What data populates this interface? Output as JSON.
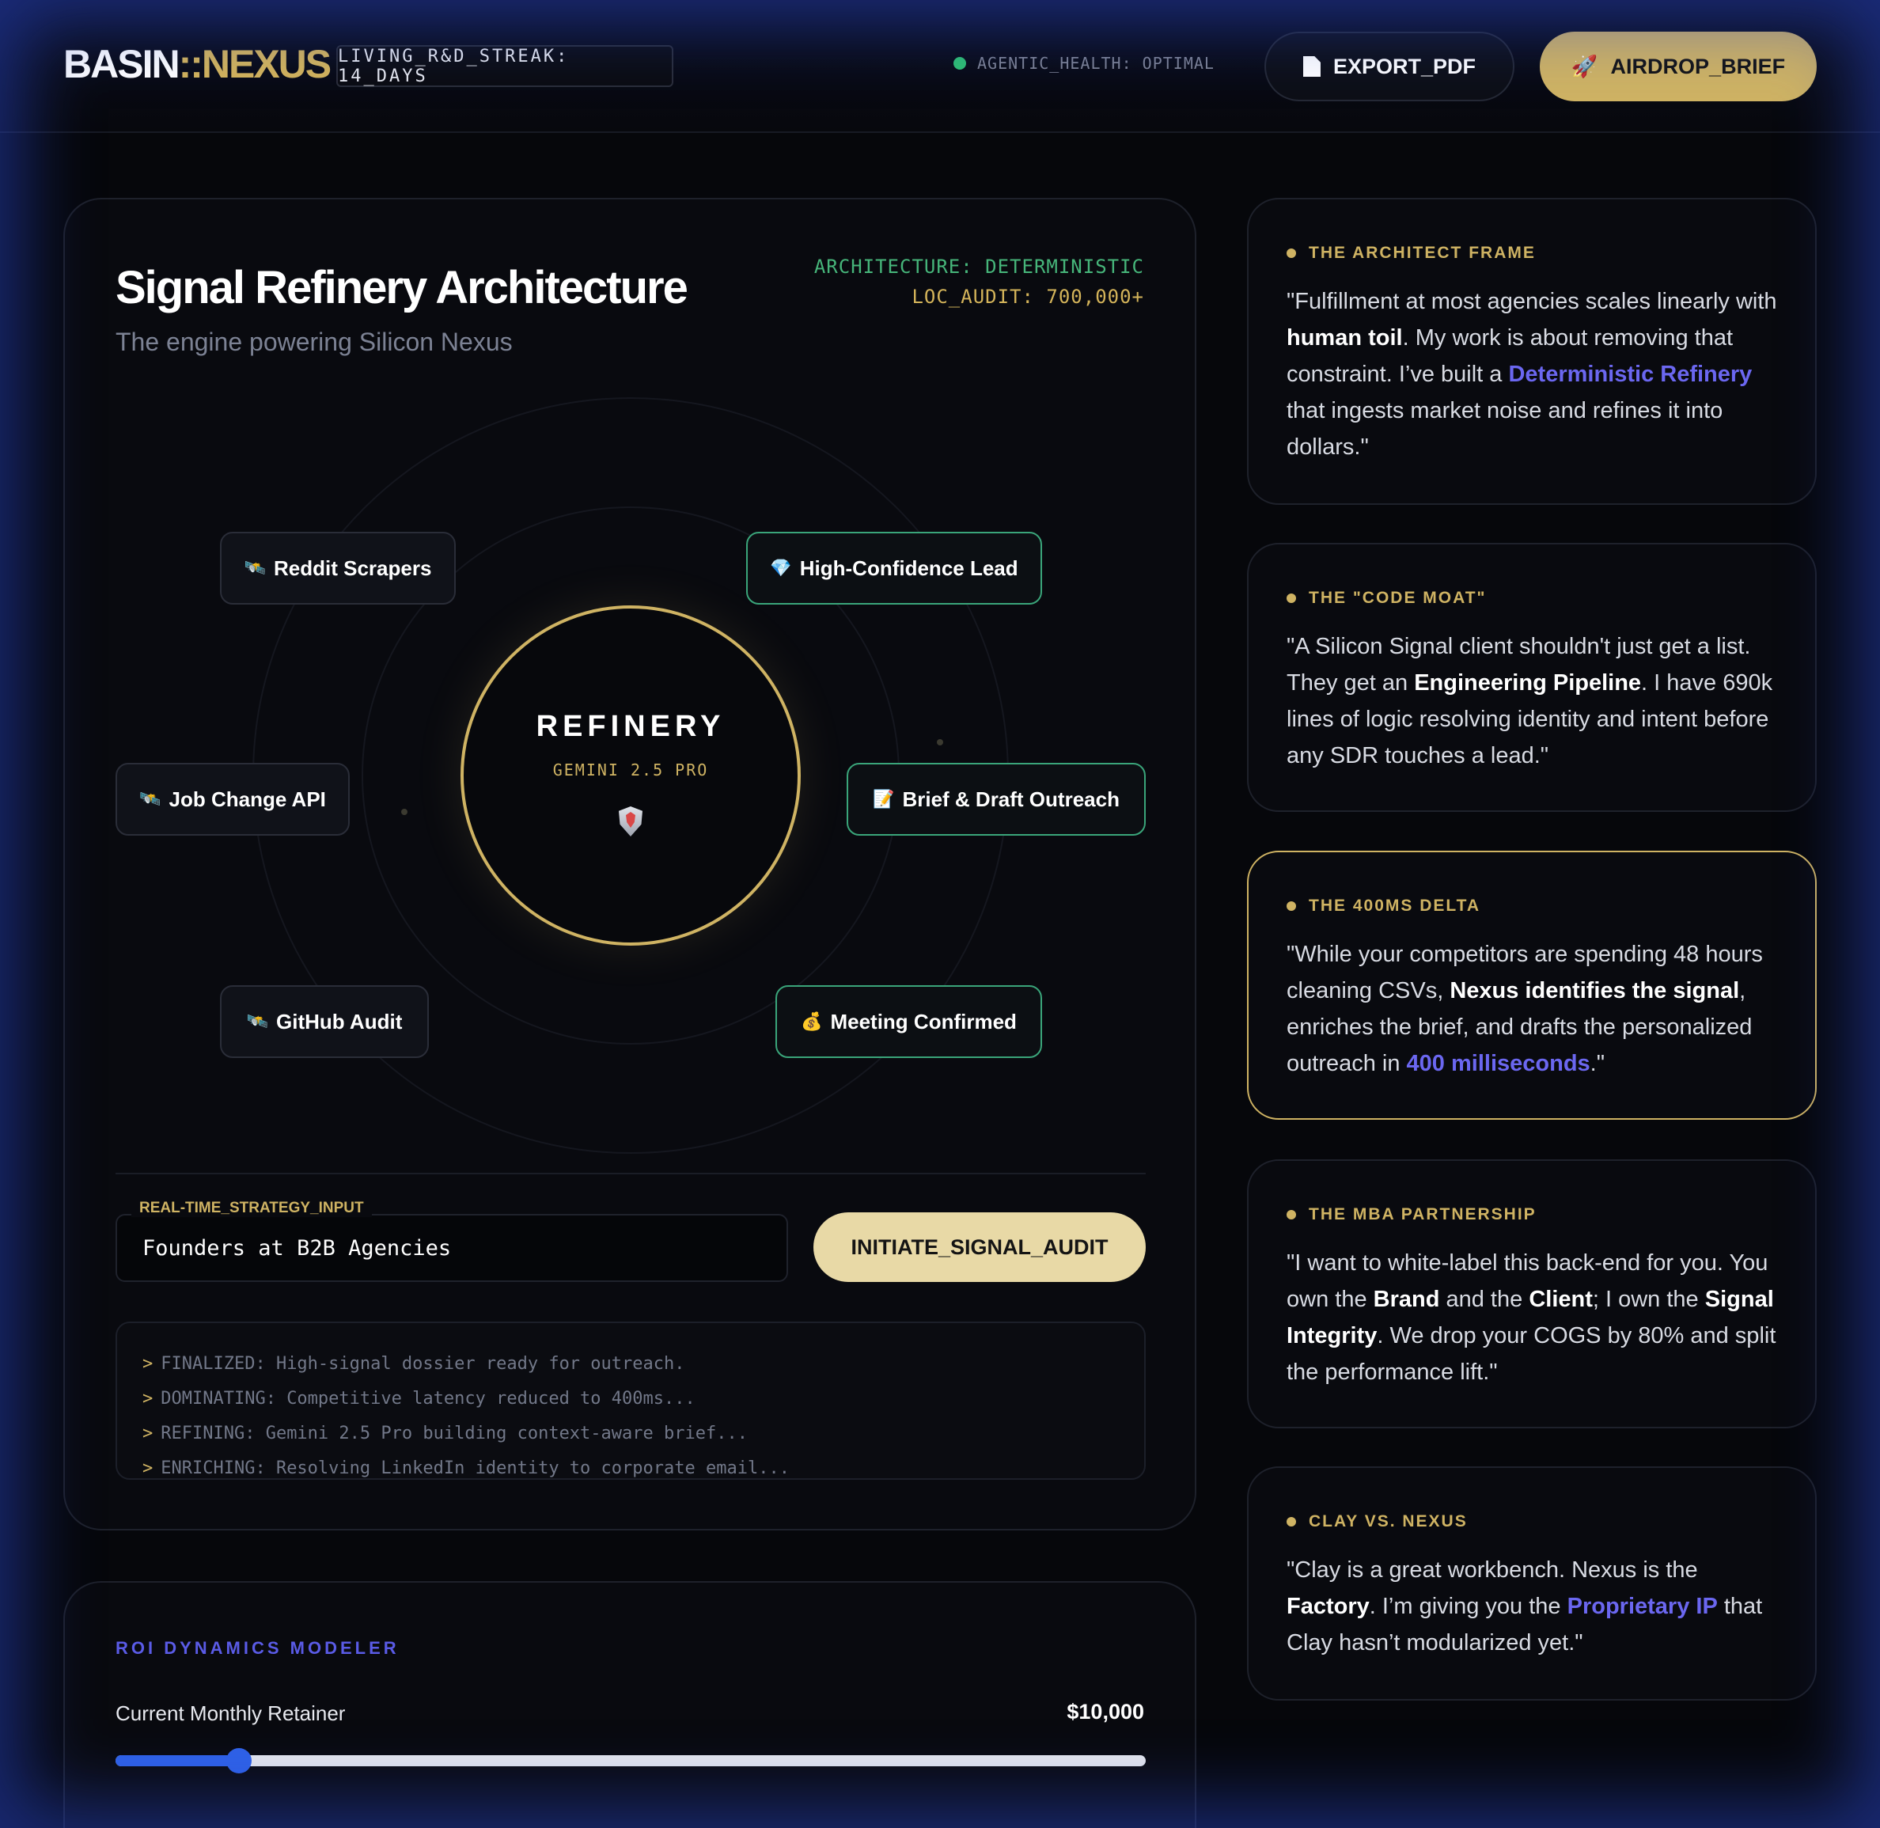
{
  "header": {
    "logo_part1": "BASIN",
    "logo_part2": "::NEXUS",
    "streak": "LIVING_R&D_STREAK: 14_DAYS",
    "health": "AGENTIC_HEALTH: OPTIMAL",
    "export_label": "EXPORT_PDF",
    "airdrop_label": "AIRDROP_BRIEF",
    "airdrop_emoji": "🚀"
  },
  "main": {
    "title": "Signal Refinery Architecture",
    "subtitle": "The engine powering Silicon Nexus",
    "arch_line1": "ARCHITECTURE: DETERMINISTIC",
    "arch_line2": "LOC_AUDIT: 700,000+",
    "core_title": "REFINERY",
    "core_sub": "GEMINI 2.5 PRO",
    "nodes": [
      {
        "emoji": "🛰️",
        "label": "Reddit Scrapers"
      },
      {
        "emoji": "🛰️",
        "label": "Job Change API"
      },
      {
        "emoji": "🛰️",
        "label": "GitHub Audit"
      },
      {
        "emoji": "💎",
        "label": "High-Confidence Lead"
      },
      {
        "emoji": "📝",
        "label": "Brief & Draft Outreach"
      },
      {
        "emoji": "💰",
        "label": "Meeting Confirmed"
      }
    ],
    "strategy_label": "REAL-TIME_STRATEGY_INPUT",
    "strategy_value": "Founders at B2B Agencies",
    "audit_button": "INITIATE_SIGNAL_AUDIT",
    "console_prompt": ">",
    "console": [
      "FINALIZED: High-signal dossier ready for outreach.",
      "DOMINATING: Competitive latency reduced to 400ms...",
      "REFINING: Gemini 2.5 Pro building context-aware brief...",
      "ENRICHING: Resolving LinkedIn identity to corporate email..."
    ]
  },
  "roi": {
    "title": "ROI DYNAMICS MODELER",
    "retainer_label": "Current Monthly Retainer",
    "retainer_value": "$10,000",
    "retainer_slider_fraction": 0.12
  },
  "cards": [
    {
      "head": "THE ARCHITECT FRAME",
      "parts": [
        {
          "t": "\"Fulfillment at most agencies scales linearly with "
        },
        {
          "t": "human toil",
          "s": "b"
        },
        {
          "t": ". My work is about removing that constraint. I’ve built a "
        },
        {
          "t": "Deterministic Refinery",
          "s": "lk"
        },
        {
          "t": " that ingests market noise and refines it into dollars.\""
        }
      ]
    },
    {
      "head": "THE \"CODE MOAT\"",
      "parts": [
        {
          "t": "\"A Silicon Signal client shouldn't just get a list. They get an "
        },
        {
          "t": "Engineering Pipeline",
          "s": "b"
        },
        {
          "t": ". I have 690k lines of logic resolving identity and intent before any SDR touches a lead.\""
        }
      ]
    },
    {
      "head": "THE 400MS DELTA",
      "parts": [
        {
          "t": "\"While your competitors are spending 48 hours cleaning CSVs, "
        },
        {
          "t": "Nexus identifies the signal",
          "s": "b"
        },
        {
          "t": ", enriches the brief, and drafts the personalized outreach in "
        },
        {
          "t": "400 milliseconds",
          "s": "lk"
        },
        {
          "t": ".\""
        }
      ]
    },
    {
      "head": "THE MBA PARTNERSHIP",
      "parts": [
        {
          "t": "\"I want to white-label this back-end for you. You own the "
        },
        {
          "t": "Brand",
          "s": "b"
        },
        {
          "t": " and the "
        },
        {
          "t": "Client",
          "s": "b"
        },
        {
          "t": "; I own the "
        },
        {
          "t": "Signal Integrity",
          "s": "b"
        },
        {
          "t": ". We drop your COGS by 80% and split the performance lift.\""
        }
      ]
    },
    {
      "head": "CLAY VS. NEXUS",
      "parts": [
        {
          "t": "\"Clay is a great workbench. Nexus is the "
        },
        {
          "t": "Factory",
          "s": "b"
        },
        {
          "t": ". I’m giving you the "
        },
        {
          "t": "Proprietary IP",
          "s": "lk"
        },
        {
          "t": " that Clay hasn’t modularized yet.\""
        }
      ]
    }
  ],
  "colors": {
    "gold": "#cfb363",
    "green": "#3aa57a",
    "indigo": "#6b67f0",
    "slider_blue": "#2f62e8"
  }
}
